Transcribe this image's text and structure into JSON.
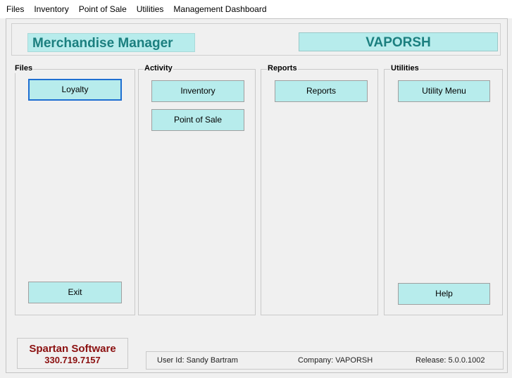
{
  "menu": [
    "Files",
    "Inventory",
    "Point of Sale",
    "Utilities",
    "Management Dashboard"
  ],
  "header": {
    "app_title": "Merchandise Manager",
    "company_title": "VAPORSH"
  },
  "groups": {
    "files": {
      "label": "Files",
      "loyalty": "Loyalty",
      "exit": "Exit"
    },
    "activity": {
      "label": "Activity",
      "inventory": "Inventory",
      "pos": "Point of Sale"
    },
    "reports": {
      "label": "Reports",
      "reports": "Reports"
    },
    "utilities": {
      "label": "Utilities",
      "utility_menu": "Utility Menu",
      "help": "Help"
    }
  },
  "vendor": {
    "name": "Spartan Software",
    "phone": "330.719.7157"
  },
  "status": {
    "user": "User Id: Sandy Bartram",
    "company": "Company: VAPORSH",
    "release": "Release: 5.0.0.1002"
  },
  "colors": {
    "button_bg": "#b7ecec",
    "title_text": "#1b7f7f",
    "vendor_text": "#8b1010"
  }
}
